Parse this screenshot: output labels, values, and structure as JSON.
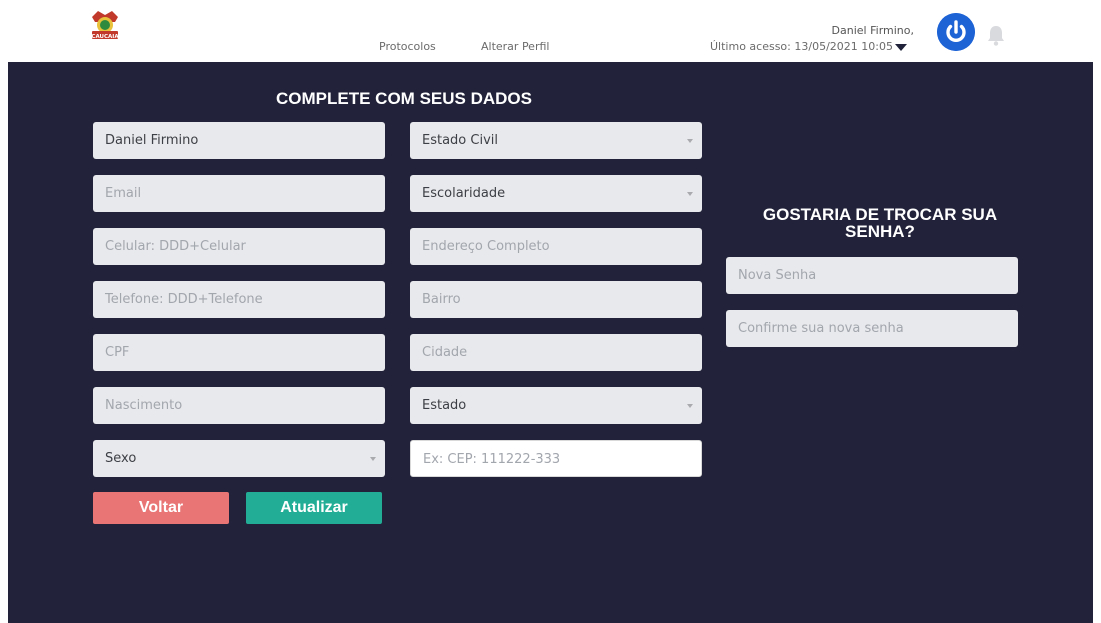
{
  "header": {
    "logo_text": "CAUCAIA",
    "nav": [
      {
        "label": "Protocolos"
      },
      {
        "label": "Alterar Perfil"
      }
    ],
    "user_name": "Daniel Firmino,",
    "last_access": "Último acesso: 13/05/2021 10:05"
  },
  "form": {
    "title": "COMPLETE COM SEUS DADOS",
    "left_fields": [
      {
        "value": "Daniel Firmino",
        "placeholder": ""
      },
      {
        "value": "",
        "placeholder": "Email"
      },
      {
        "value": "",
        "placeholder": "Celular: DDD+Celular"
      },
      {
        "value": "",
        "placeholder": "Telefone: DDD+Telefone"
      },
      {
        "value": "",
        "placeholder": "CPF"
      },
      {
        "value": "",
        "placeholder": "Nascimento"
      },
      {
        "value": "Sexo",
        "placeholder": ""
      }
    ],
    "right_fields": [
      {
        "value": "Estado Civil",
        "placeholder": ""
      },
      {
        "value": "Escolaridade",
        "placeholder": ""
      },
      {
        "value": "",
        "placeholder": "Endereço Completo"
      },
      {
        "value": "",
        "placeholder": "Bairro"
      },
      {
        "value": "",
        "placeholder": "Cidade"
      },
      {
        "value": "Estado",
        "placeholder": ""
      },
      {
        "value": "",
        "placeholder": "Ex: CEP: 111222-333"
      }
    ],
    "buttons": {
      "back": "Voltar",
      "update": "Atualizar"
    }
  },
  "password": {
    "title": "GOSTARIA DE TROCAR SUA SENHA?",
    "new_placeholder": "Nova Senha",
    "confirm_placeholder": "Confirme sua nova senha"
  },
  "colors": {
    "panel_bg": "#22233a",
    "field_bg": "#e8e9ec",
    "back_button": "#e97575",
    "update_button": "#22ae96",
    "power_button": "#1d63d6"
  },
  "icons": [
    "logo",
    "power-icon",
    "bell-icon",
    "caret-down-icon",
    "select-arrow-icon"
  ]
}
